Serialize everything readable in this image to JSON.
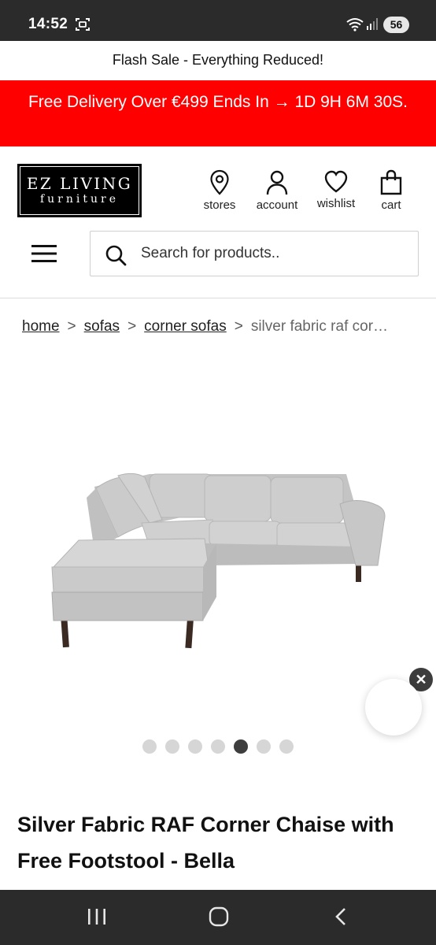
{
  "status_bar": {
    "time": "14:52",
    "battery": "56",
    "icons": [
      "screen-record-icon",
      "wifi-icon",
      "signal-icon"
    ]
  },
  "flash_bar": {
    "text": "Flash Sale - Everything Reduced!"
  },
  "promo_bar": {
    "text": "Free Delivery Over €499 Ends In → 1D 9H 6M 30S.",
    "color": "#ff0000"
  },
  "logo": {
    "line1": "EZ LIVING",
    "line2": "furniture"
  },
  "header_nav": {
    "stores": "stores",
    "account": "account",
    "wishlist": "wishlist",
    "cart": "cart"
  },
  "search": {
    "placeholder": "Search for products.."
  },
  "breadcrumb": {
    "home": "home",
    "sofas": "sofas",
    "corner_sofas": "corner sofas",
    "current": "silver fabric raf cor…",
    "separator": ">"
  },
  "gallery": {
    "total_images": 7,
    "active_index": 5,
    "image_alt": "Silver fabric corner sofa with chaise"
  },
  "chat": {
    "close_label": "✕"
  },
  "product": {
    "title": "Silver Fabric RAF Corner Chaise with Free Footstool - Bella"
  },
  "android_nav": {
    "icons": [
      "recent-apps-icon",
      "home-icon",
      "back-icon"
    ]
  }
}
